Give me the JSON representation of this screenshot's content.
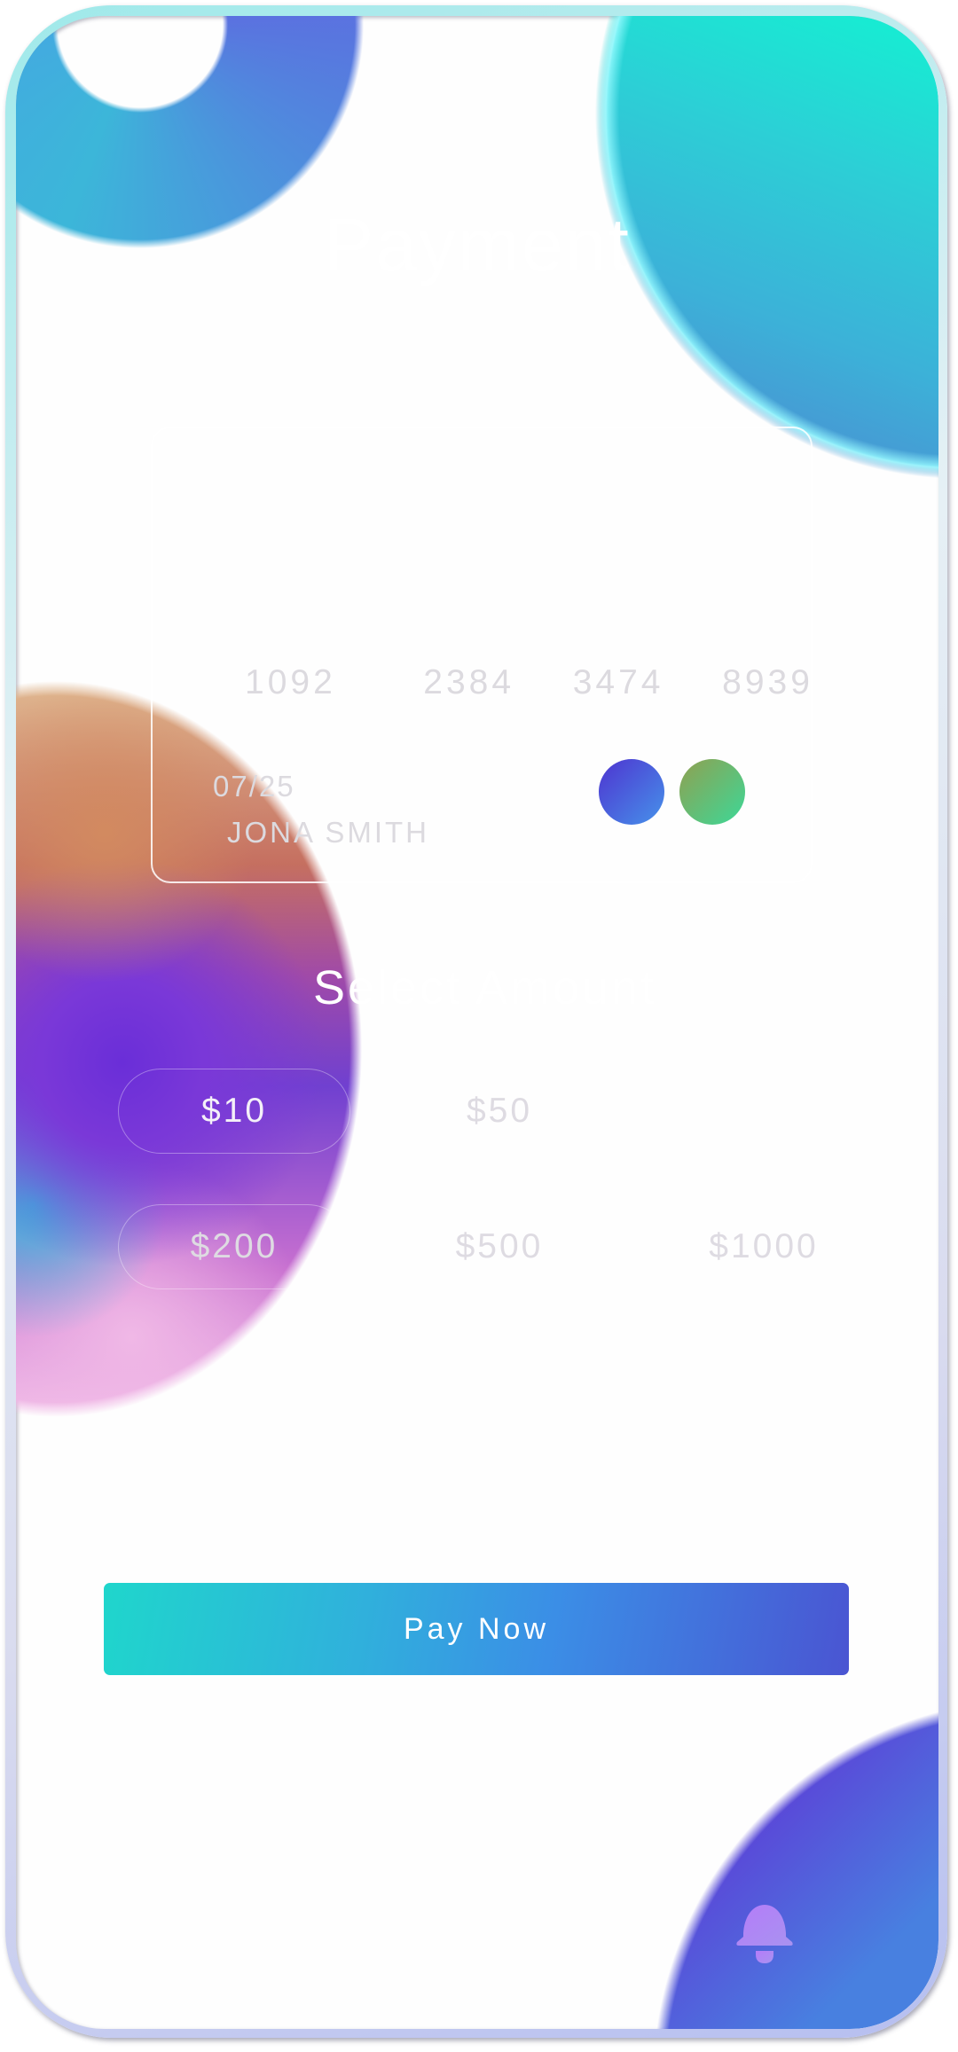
{
  "header": {
    "title": "Payment"
  },
  "card": {
    "number": "1092   2384  3474  8939",
    "expiry": "07/25",
    "holder": "JONA SMITH",
    "brand_colors": [
      "#4e34d0",
      "#3cd898"
    ]
  },
  "amounts": {
    "heading": "Select Amount",
    "options": [
      {
        "label": "$10",
        "selected": true
      },
      {
        "label": "$50",
        "selected": false
      },
      {
        "label": "$200",
        "selected": false
      },
      {
        "label": "$500",
        "selected": false
      },
      {
        "label": "$1000",
        "selected": false
      }
    ]
  },
  "actions": {
    "pay_label": "Pay Now"
  },
  "nav": {
    "icon": "bell-icon"
  },
  "colors": {
    "accent_start": "#1fd6cc",
    "accent_end": "#4a55d2",
    "bell": "#b07ef8"
  }
}
